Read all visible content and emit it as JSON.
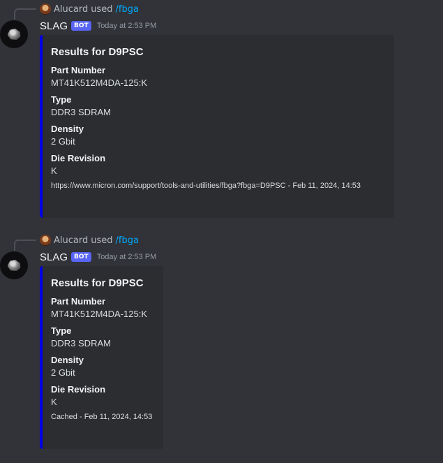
{
  "messages": [
    {
      "reply": {
        "user": "Alucard",
        "used_text": "used",
        "command": "/fbga"
      },
      "author": "SLAG",
      "bot_tag": "BOT",
      "timestamp": "Today at 2:53 PM",
      "embed": {
        "title": "Results for D9PSC",
        "fields": [
          {
            "name": "Part Number",
            "value": "MT41K512M4DA-125:K"
          },
          {
            "name": "Type",
            "value": "DDR3 SDRAM"
          },
          {
            "name": "Density",
            "value": "2 Gbit"
          },
          {
            "name": "Die Revision",
            "value": "K"
          }
        ],
        "footer": "https://www.micron.com/support/tools-and-utilities/fbga?fbga=D9PSC - Feb 11, 2024, 14:53"
      }
    },
    {
      "reply": {
        "user": "Alucard",
        "used_text": "used",
        "command": "/fbga"
      },
      "author": "SLAG",
      "bot_tag": "BOT",
      "timestamp": "Today at 2:53 PM",
      "embed": {
        "title": "Results for D9PSC",
        "fields": [
          {
            "name": "Part Number",
            "value": "MT41K512M4DA-125:K"
          },
          {
            "name": "Type",
            "value": "DDR3 SDRAM"
          },
          {
            "name": "Density",
            "value": "2 Gbit"
          },
          {
            "name": "Die Revision",
            "value": "K"
          }
        ],
        "footer": "Cached - Feb 11, 2024, 14:53"
      }
    }
  ],
  "colors": {
    "background": "#313338",
    "embed_background": "#2b2d31",
    "embed_accent": "#0000e6",
    "bot_tag": "#5865f2",
    "command_link": "#00a8fc"
  },
  "icons": [
    "bot-avatar-icon",
    "user-avatar-icon"
  ]
}
